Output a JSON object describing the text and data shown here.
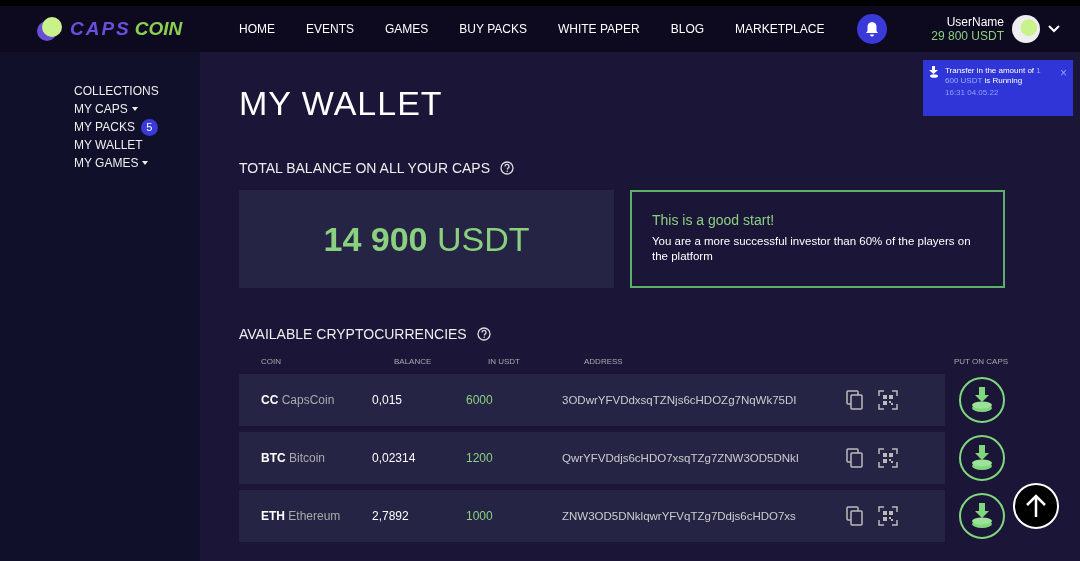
{
  "logo": {
    "word1": "CAPS",
    "word2": "COIN"
  },
  "nav": [
    {
      "label": "HOME"
    },
    {
      "label": "EVENTS"
    },
    {
      "label": "GAMES"
    },
    {
      "label": "BUY PACKS"
    },
    {
      "label": "WHITE PAPER"
    },
    {
      "label": "BLOG"
    },
    {
      "label": "MARKETPLACE"
    }
  ],
  "user": {
    "name": "UserName",
    "balance": "29 800 USDT"
  },
  "notification": {
    "before": "Transfer in the amount of",
    "amount": "1 600 USDT",
    "after": "is Running",
    "time": "16:31  04.05.22",
    "close": "×"
  },
  "sidebar": {
    "items": [
      {
        "label": "COLLECTIONS",
        "dropdown": false
      },
      {
        "label": "MY CAPS",
        "dropdown": true
      },
      {
        "label": "MY PACKS",
        "dropdown": false,
        "badge": "5"
      },
      {
        "label": "MY WALLET",
        "dropdown": false
      },
      {
        "label": "MY GAMES",
        "dropdown": true
      }
    ]
  },
  "page_title": "MY WALLET",
  "balance_section": {
    "heading": "TOTAL BALANCE ON ALL YOUR CAPS",
    "amount": "14 900",
    "currency": "USDT",
    "card_title": "This is a good start!",
    "card_text": "You are a more successful investor than 60% of the players on the platform"
  },
  "crypto_section": {
    "heading": "AVAILABLE CRYPTOCURRENCIES",
    "columns": [
      "COIN",
      "BALANCE",
      "IN USDT",
      "ADDRESS",
      "PUT ON CAPS"
    ],
    "rows": [
      {
        "ticker": "CC",
        "name": "CapsCoin",
        "balance": "0,015",
        "usdt": "6000",
        "address": "3ODwrYFVDdxsqTZNjs6cHDOZg7NqWk75DI"
      },
      {
        "ticker": "BTC",
        "name": "Bitcoin",
        "balance": "0,02314",
        "usdt": "1200",
        "address": "QwrYFVDdjs6cHDO7xsqTZg7ZNW3OD5DNkI"
      },
      {
        "ticker": "ETH",
        "name": "Ethereum",
        "balance": "2,7892",
        "usdt": "1000",
        "address": "ZNW3OD5DNklqwrYFVqTZg7Ddjs6cHDO7xs"
      }
    ]
  }
}
